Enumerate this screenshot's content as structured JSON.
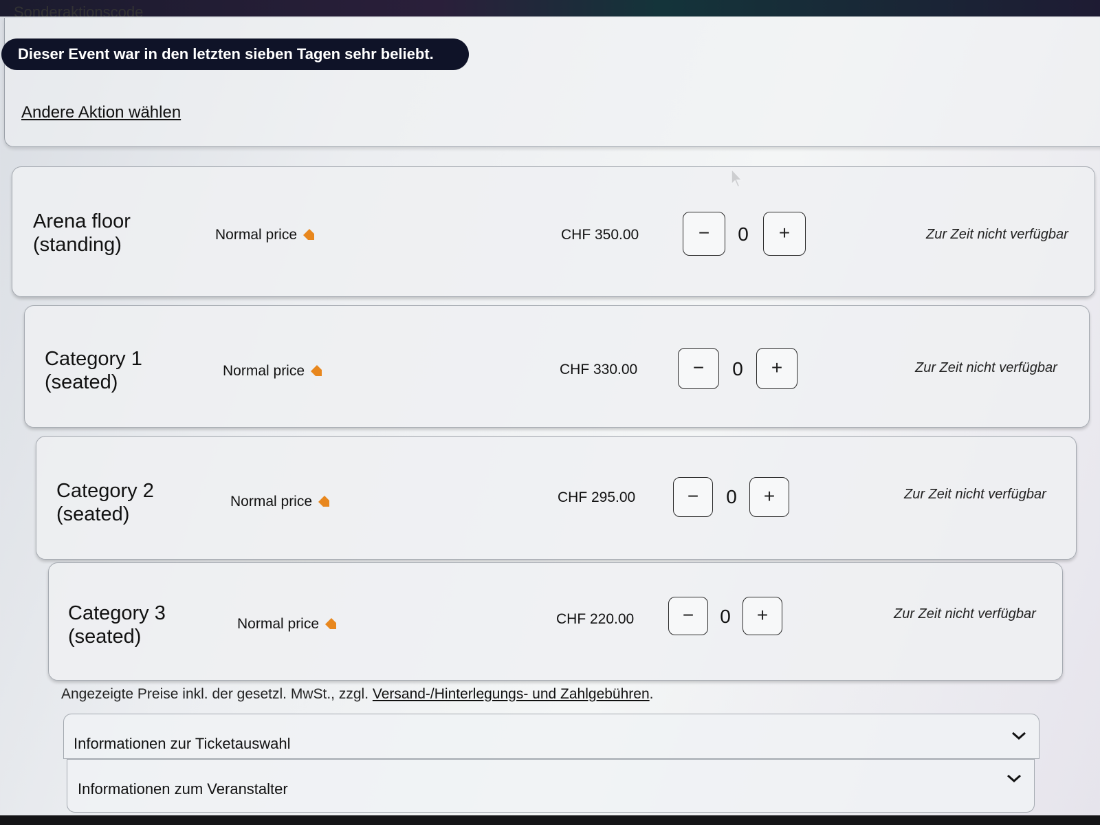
{
  "header": {
    "cut_label": "Sonderaktionscode",
    "popular_banner": "Dieser Event war in den letzten sieben Tagen sehr beliebt.",
    "other_action_link": "Andere Aktion wählen"
  },
  "tickets": [
    {
      "title_line1": "Arena floor",
      "title_line2": "(standing)",
      "price_type": "Normal price",
      "price": "CHF 350.00",
      "quantity": "0",
      "availability": "Zur Zeit nicht verfügbar"
    },
    {
      "title_line1": "Category 1",
      "title_line2": "(seated)",
      "price_type": "Normal price",
      "price": "CHF 330.00",
      "quantity": "0",
      "availability": "Zur Zeit nicht verfügbar"
    },
    {
      "title_line1": "Category 2",
      "title_line2": "(seated)",
      "price_type": "Normal price",
      "price": "CHF 295.00",
      "quantity": "0",
      "availability": "Zur Zeit nicht verfügbar"
    },
    {
      "title_line1": "Category 3",
      "title_line2": "(seated)",
      "price_type": "Normal price",
      "price": "CHF 220.00",
      "quantity": "0",
      "availability": "Zur Zeit nicht verfügbar"
    }
  ],
  "controls": {
    "minus": "−",
    "plus": "+"
  },
  "footnote": {
    "text": "Angezeigte Preise inkl. der gesetzl. MwSt., zzgl. ",
    "link": "Versand-/Hinterlegungs- und Zahlgebühren",
    "end": "."
  },
  "accordions": {
    "ticket_info": "Informationen zur Ticketauswahl",
    "organizer_info": "Informationen zum Veranstalter"
  },
  "colors": {
    "tag": "#e8871e",
    "banner_bg": "#0f1328"
  }
}
